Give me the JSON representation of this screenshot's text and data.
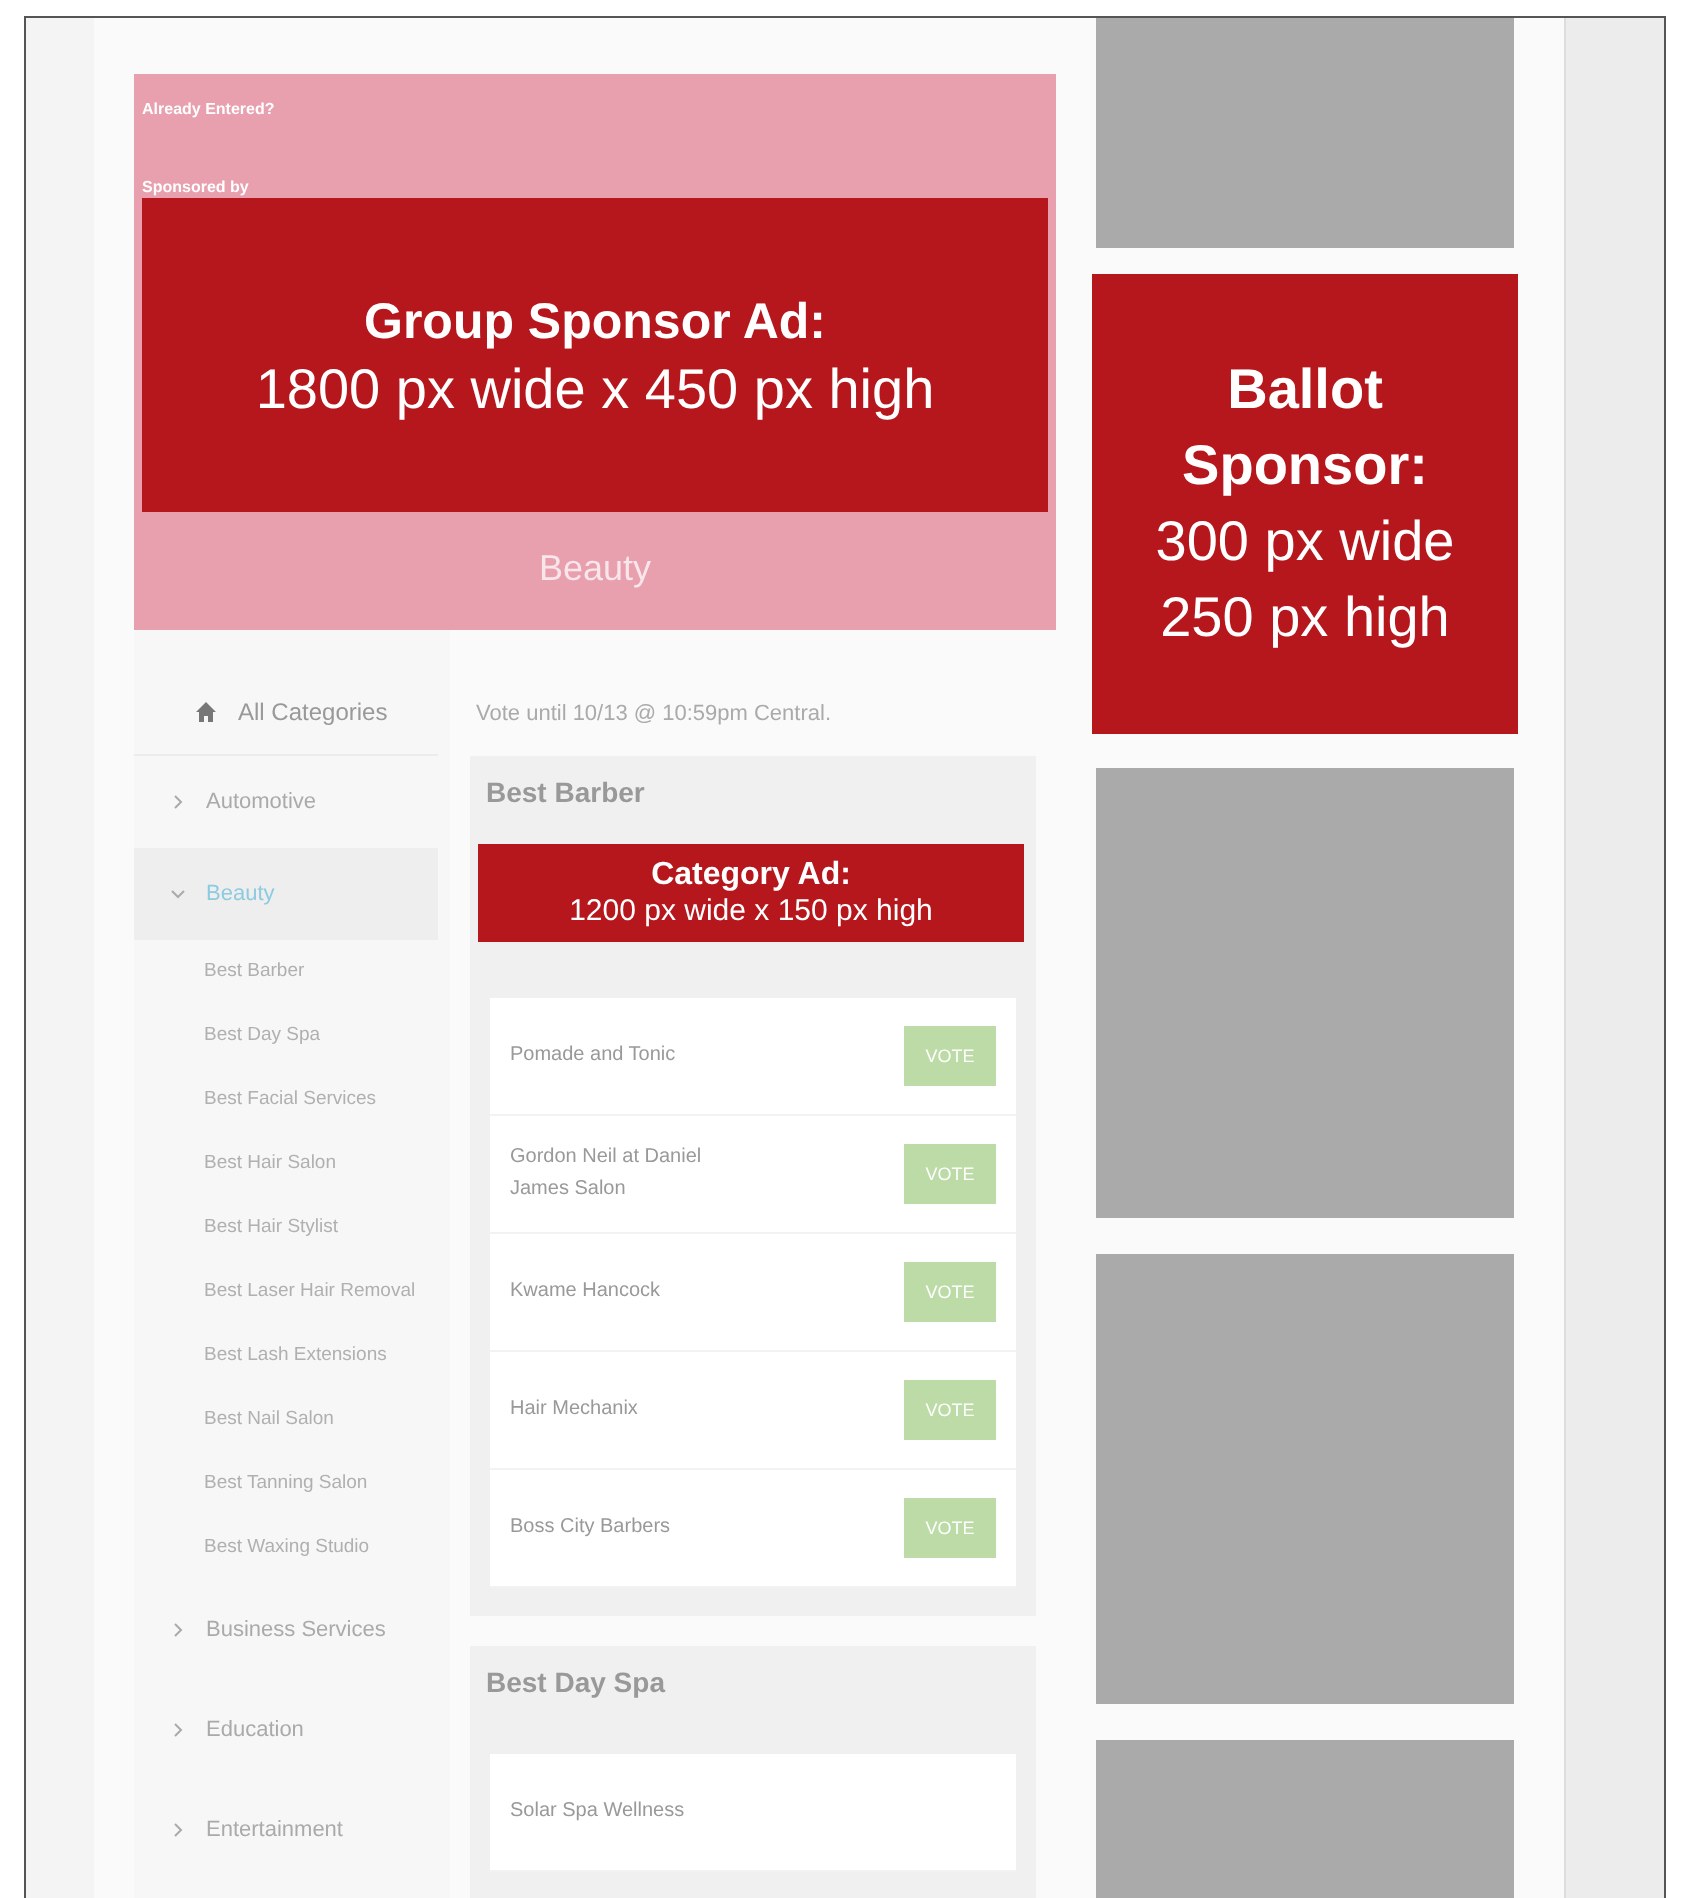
{
  "header": {
    "already_entered": "Already Entered?",
    "sponsored_by": "Sponsored by",
    "group_ad": {
      "title": "Group Sponsor Ad:",
      "size": "1800 px wide x 450 px high"
    },
    "category_name": "Beauty"
  },
  "sidebar": {
    "all_categories": "All Categories",
    "items": [
      {
        "label": "Automotive",
        "expanded": false
      },
      {
        "label": "Beauty",
        "expanded": true,
        "children": [
          "Best Barber",
          "Best Day Spa",
          "Best Facial Services",
          "Best Hair Salon",
          "Best Hair Stylist",
          "Best Laser Hair Removal",
          "Best Lash Extensions",
          "Best Nail Salon",
          "Best Tanning Salon",
          "Best Waxing Studio"
        ]
      },
      {
        "label": "Business Services",
        "expanded": false
      },
      {
        "label": "Education",
        "expanded": false
      },
      {
        "label": "Entertainment",
        "expanded": false
      }
    ]
  },
  "vote_deadline": "Vote until 10/13 @ 10:59pm Central.",
  "sections": [
    {
      "title": "Best Barber",
      "category_ad": {
        "title": "Category Ad:",
        "size": "1200 px wide x 150 px high"
      },
      "nominees": [
        {
          "name": "Pomade and Tonic",
          "button": "VOTE"
        },
        {
          "name": "Gordon Neil at Daniel James Salon",
          "button": "VOTE"
        },
        {
          "name": "Kwame Hancock",
          "button": "VOTE"
        },
        {
          "name": "Hair Mechanix",
          "button": "VOTE"
        },
        {
          "name": "Boss City Barbers",
          "button": "VOTE"
        }
      ]
    },
    {
      "title": "Best Day Spa",
      "nominees": [
        {
          "name": "Solar Spa Wellness"
        }
      ]
    }
  ],
  "ballot_ad": {
    "title": "Ballot Sponsor:",
    "size_lines": [
      "300 px wide",
      "250 px high"
    ]
  }
}
